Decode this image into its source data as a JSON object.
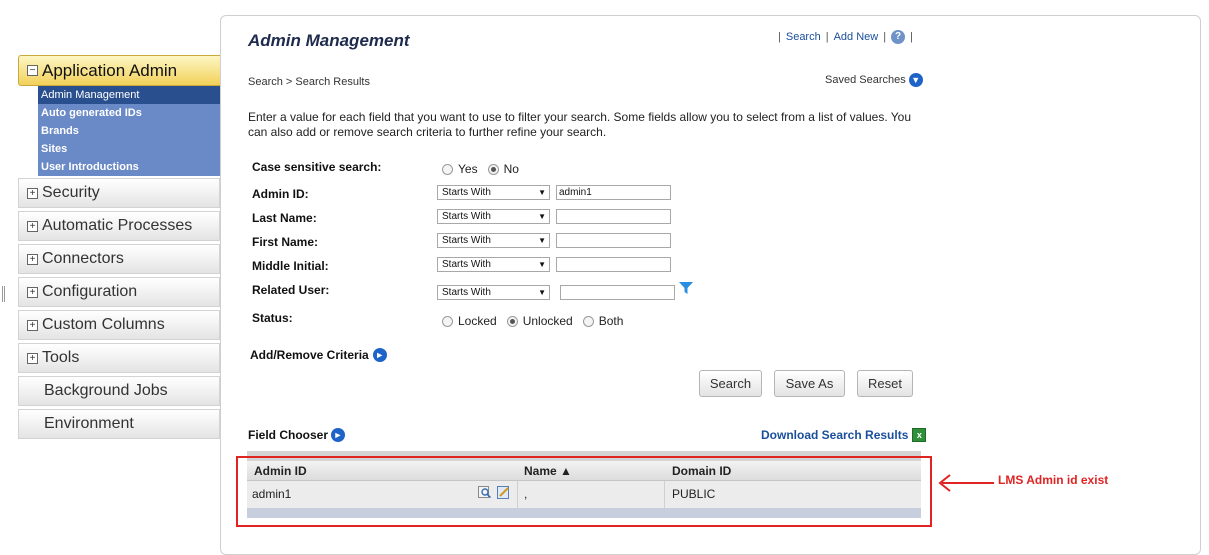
{
  "sidebar": {
    "active_section": "Application Admin",
    "submenu": [
      "Admin Management",
      "Auto generated IDs",
      "Brands",
      "Sites",
      "User Introductions"
    ],
    "items": [
      "Security",
      "Automatic Processes",
      "Connectors",
      "Configuration",
      "Custom Columns",
      "Tools"
    ],
    "plain_items": [
      "Background Jobs",
      "Environment"
    ]
  },
  "header": {
    "title": "Admin Management",
    "link_search": "Search",
    "link_add_new": "Add New",
    "help_symbol": "?"
  },
  "breadcrumb": "Search > Search Results",
  "saved_searches": "Saved Searches",
  "intro": "Enter a value for each field that you want to use to filter your search. Some fields allow you to select from a list of values. You can also add or remove search criteria to further refine your search.",
  "form": {
    "case_label": "Case sensitive search:",
    "case_yes": "Yes",
    "case_no": "No",
    "fields": [
      {
        "label": "Admin ID:",
        "operator": "Starts With",
        "value": "admin1"
      },
      {
        "label": "Last Name:",
        "operator": "Starts With",
        "value": ""
      },
      {
        "label": "First Name:",
        "operator": "Starts With",
        "value": ""
      },
      {
        "label": "Middle Initial:",
        "operator": "Starts With",
        "value": ""
      },
      {
        "label": "Related User:",
        "operator": "Starts With",
        "value": ""
      }
    ],
    "status_label": "Status:",
    "status_locked": "Locked",
    "status_unlocked": "Unlocked",
    "status_both": "Both",
    "add_remove": "Add/Remove Criteria",
    "btn_search": "Search",
    "btn_save_as": "Save As",
    "btn_reset": "Reset"
  },
  "results": {
    "field_chooser": "Field Chooser",
    "download": "Download Search Results",
    "col_admin_id": "Admin ID",
    "col_name": "Name ▲",
    "col_domain": "Domain ID",
    "row_admin_id": "admin1",
    "row_name": ",",
    "row_domain": "PUBLIC"
  },
  "annotation": "LMS Admin id exist",
  "colors": {
    "accent": "#1a4f9c",
    "highlight": "#e02323",
    "submenu": "#6a89c7"
  }
}
